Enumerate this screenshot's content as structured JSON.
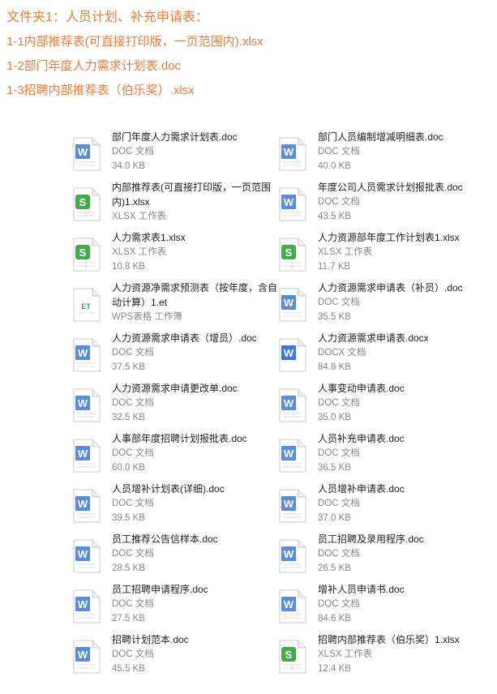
{
  "header": {
    "title": "文件夹1：人员计划、补充申请表：",
    "lines": [
      "1-1内部推荐表(可直接打印版，一页范围内).xlsx",
      "1-2部门年度人力需求计划表.doc",
      "1-3招聘内部推荐表（伯乐奖）.xlsx"
    ]
  },
  "colors": {
    "accent": "#f07a3c",
    "word": "#3b78d8",
    "excel": "#3fae47",
    "et": "#4aa05a"
  },
  "files": [
    {
      "name": "部门年度人力需求计划表.doc",
      "type": "DOC 文档",
      "size": "34.0 KB",
      "icon": "word-doc-icon"
    },
    {
      "name": "部门人员编制增减明细表.doc",
      "type": "DOC 文档",
      "size": "40.0 KB",
      "icon": "word-doc-icon"
    },
    {
      "name": "内部推荐表(可直接打印版，一页范围内)1.xlsx",
      "type": "XLSX 工作表",
      "size": "",
      "icon": "excel-xlsx-icon"
    },
    {
      "name": "年度公司人员需求计划报批表.doc",
      "type": "DOC 文档",
      "size": "43.5 KB",
      "icon": "word-doc-icon"
    },
    {
      "name": "人力需求表1.xlsx",
      "type": "XLSX 工作表",
      "size": "10.8 KB",
      "icon": "excel-xlsx-icon"
    },
    {
      "name": "人力资源部年度工作计划表1.xlsx",
      "type": "XLSX 工作表",
      "size": "11.7 KB",
      "icon": "excel-xlsx-icon"
    },
    {
      "name": "人力资源净需求预测表（按年度，含自动计算）1.et",
      "type": "WPS表格 工作簿",
      "size": "",
      "icon": "wps-et-icon"
    },
    {
      "name": "人力资源需求申请表（补员）.doc",
      "type": "DOC 文档",
      "size": "35.5 KB",
      "icon": "word-doc-icon"
    },
    {
      "name": "人力资源需求申请表（增员）.doc",
      "type": "DOC 文档",
      "size": "37.5 KB",
      "icon": "word-doc-icon"
    },
    {
      "name": "人力资源需求申请表.docx",
      "type": "DOCX 文档",
      "size": "84.8 KB",
      "icon": "word-docx-icon"
    },
    {
      "name": "人力资源需求申请更改单.doc",
      "type": "DOC 文档",
      "size": "32.5 KB",
      "icon": "word-doc-icon"
    },
    {
      "name": "人事变动申请表.doc",
      "type": "DOC 文档",
      "size": "35.0 KB",
      "icon": "word-doc-icon"
    },
    {
      "name": "人事部年度招聘计划报批表.doc",
      "type": "DOC 文档",
      "size": "60.0 KB",
      "icon": "word-doc-icon"
    },
    {
      "name": "人员补充申请表.doc",
      "type": "DOC 文档",
      "size": "36.5 KB",
      "icon": "word-doc-icon"
    },
    {
      "name": "人员增补计划表(详细).doc",
      "type": "DOC 文档",
      "size": "39.5 KB",
      "icon": "word-doc-icon"
    },
    {
      "name": "人员增补申请表.doc",
      "type": "DOC 文档",
      "size": "37.0 KB",
      "icon": "word-doc-icon"
    },
    {
      "name": "员工推荐公告信样本.doc",
      "type": "DOC 文档",
      "size": "28.5 KB",
      "icon": "word-doc-icon"
    },
    {
      "name": "员工招聘及录用程序.doc",
      "type": "DOC 文档",
      "size": "26.5 KB",
      "icon": "word-doc-icon"
    },
    {
      "name": "员工招聘申请程序.doc",
      "type": "DOC 文档",
      "size": "27.5 KB",
      "icon": "word-doc-icon"
    },
    {
      "name": "增补人员申请书.doc",
      "type": "DOC 文档",
      "size": "84.6 KB",
      "icon": "word-doc-icon"
    },
    {
      "name": "招聘计划范本.doc",
      "type": "DOC 文档",
      "size": "45.5 KB",
      "icon": "word-doc-icon"
    },
    {
      "name": "招聘内部推荐表（伯乐奖）1.xlsx",
      "type": "XLSX 工作表",
      "size": "12.4 KB",
      "icon": "excel-xlsx-icon"
    }
  ]
}
